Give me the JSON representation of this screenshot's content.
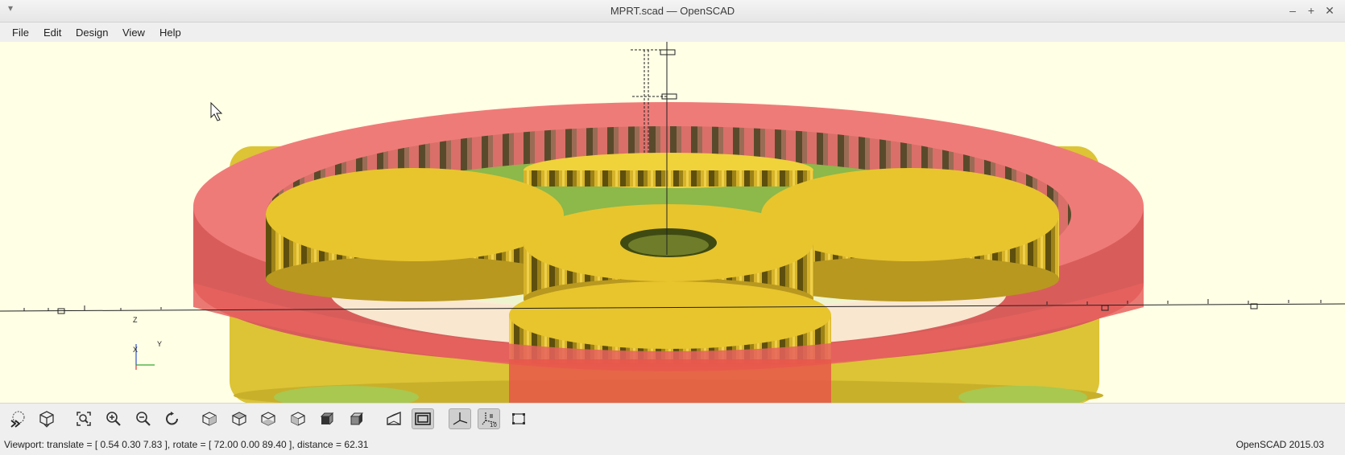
{
  "window": {
    "title": "MPRT.scad — OpenSCAD",
    "menu_glyph": "▾",
    "controls": {
      "minimize": "–",
      "maximize": "+",
      "close": "✕"
    }
  },
  "menu": [
    "File",
    "Edit",
    "Design",
    "View",
    "Help"
  ],
  "viewport": {
    "background": "#ffffe5",
    "axis_labels": {
      "z": "Z",
      "y": "Y",
      "x": "X"
    },
    "colors": {
      "ring": "#e8615f",
      "ring_top": "#ef7b78",
      "planet": "#e3c228",
      "carrier": "#8db84a",
      "base": "#dcc436"
    }
  },
  "toolbar": [
    {
      "name": "render-preview-button",
      "icon": "preview-icon"
    },
    {
      "name": "render-button",
      "icon": "render-cube-icon"
    },
    {
      "name": "view-all-button",
      "icon": "view-all-icon"
    },
    {
      "name": "zoom-in-button",
      "icon": "zoom-in-icon"
    },
    {
      "name": "zoom-out-button",
      "icon": "zoom-out-icon"
    },
    {
      "name": "reset-view-button",
      "icon": "reset-view-icon"
    },
    {
      "name": "view-right-button",
      "icon": "view-right-icon"
    },
    {
      "name": "view-top-button",
      "icon": "view-top-icon"
    },
    {
      "name": "view-bottom-button",
      "icon": "view-bottom-icon"
    },
    {
      "name": "view-left-button",
      "icon": "view-left-icon"
    },
    {
      "name": "view-front-button",
      "icon": "view-front-icon"
    },
    {
      "name": "view-back-button",
      "icon": "view-back-icon"
    },
    {
      "name": "perspective-button",
      "icon": "perspective-icon"
    },
    {
      "name": "orthogonal-button",
      "icon": "orthogonal-icon",
      "active": true
    },
    {
      "name": "show-axes-button",
      "icon": "axes-icon",
      "active": true
    },
    {
      "name": "show-scale-button",
      "icon": "scale-markers-icon",
      "active": true
    },
    {
      "name": "show-edges-button",
      "icon": "edges-icon"
    }
  ],
  "status": {
    "viewport_info": "Viewport: translate = [ 0.54 0.30 7.83 ], rotate = [ 72.00 0.00 89.40 ], distance = 62.31",
    "version": "OpenSCAD 2015.03"
  }
}
